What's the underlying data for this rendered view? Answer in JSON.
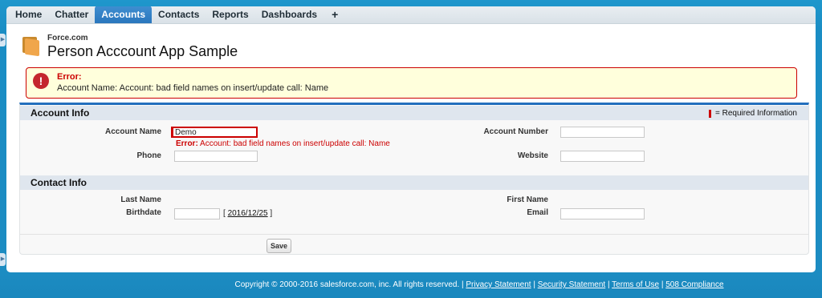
{
  "tabs": [
    "Home",
    "Chatter",
    "Accounts",
    "Contacts",
    "Reports",
    "Dashboards",
    "+"
  ],
  "active_tab": "Accounts",
  "header": {
    "subtitle": "Force.com",
    "title": "Person Acccount App Sample"
  },
  "error": {
    "title": "Error:",
    "message": "Account Name: Account: bad field names on insert/update call: Name",
    "icon": "!"
  },
  "account_info": {
    "heading": "Account Info",
    "required_note": "= Required Information",
    "account_name_label": "Account Name",
    "account_name_value": "Demo",
    "account_name_error_prefix": "Error:",
    "account_name_error_text": "Account: bad field names on insert/update call: Name",
    "phone_label": "Phone",
    "account_number_label": "Account Number",
    "website_label": "Website"
  },
  "contact_info": {
    "heading": "Contact Info",
    "last_name_label": "Last Name",
    "birthdate_label": "Birthdate",
    "birthdate_today": "2016/12/25",
    "first_name_label": "First Name",
    "email_label": "Email"
  },
  "save_label": "Save",
  "footer": {
    "copyright": "Copyright © 2000-2016 salesforce.com, inc. All rights reserved.",
    "links": [
      "Privacy Statement",
      "Security Statement",
      "Terms of Use",
      "508 Compliance"
    ]
  },
  "colors": {
    "page_bg": "#1a8dc4",
    "active_tab": "#2a76bd",
    "error_red": "#cc0000",
    "error_bg": "#ffffdc"
  }
}
